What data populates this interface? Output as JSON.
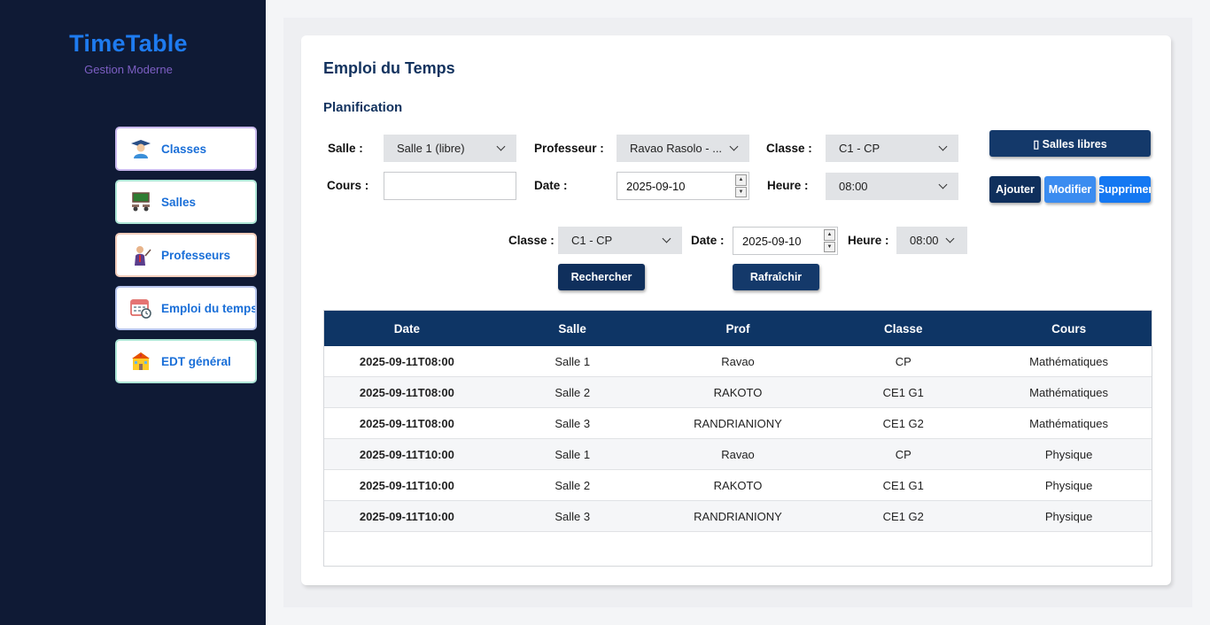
{
  "brand": {
    "title": "TimeTable",
    "subtitle": "Gestion Moderne"
  },
  "sidebar": {
    "items": [
      {
        "label": "Classes",
        "icon": "student-icon"
      },
      {
        "label": "Salles",
        "icon": "classroom-icon"
      },
      {
        "label": "Professeurs",
        "icon": "teacher-icon"
      },
      {
        "label": "Emploi du temps",
        "icon": "calendar-clock-icon"
      },
      {
        "label": "EDT général",
        "icon": "school-building-icon"
      }
    ]
  },
  "main": {
    "title": "Emploi du Temps",
    "section": "Planification",
    "form": {
      "salle_label": "Salle :",
      "salle_value": "Salle 1 (libre)",
      "professeur_label": "Professeur :",
      "professeur_value": "Ravao Rasolo - ...",
      "classe_label": "Classe :",
      "classe_value": "C1 - CP",
      "cours_label": "Cours :",
      "cours_value": "",
      "date_label": "Date :",
      "date_value": "2025-09-10",
      "heure_label": "Heure :",
      "heure_value": "08:00"
    },
    "buttons": {
      "salles_libres": "▯ Salles libres",
      "ajouter": "Ajouter",
      "modifier": "Modifier",
      "supprimer": "Supprimer"
    },
    "search": {
      "classe_label": "Classe :",
      "classe_value": "C1 - CP",
      "date_label": "Date :",
      "date_value": "2025-09-10",
      "heure_label": "Heure :",
      "heure_value": "08:00",
      "rechercher": "Rechercher",
      "rafraichir": "Rafraîchir"
    },
    "table": {
      "columns": [
        "Date",
        "Salle",
        "Prof",
        "Classe",
        "Cours"
      ],
      "rows": [
        [
          "2025-09-11T08:00",
          "Salle 1",
          "Ravao",
          "CP",
          "Mathématiques"
        ],
        [
          "2025-09-11T08:00",
          "Salle 2",
          "RAKOTO",
          "CE1 G1",
          "Mathématiques"
        ],
        [
          "2025-09-11T08:00",
          "Salle 3",
          "RANDRIANIONY",
          "CE1 G2",
          "Mathématiques"
        ],
        [
          "2025-09-11T10:00",
          "Salle 1",
          "Ravao",
          "CP",
          "Physique"
        ],
        [
          "2025-09-11T10:00",
          "Salle 2",
          "RAKOTO",
          "CE1 G1",
          "Physique"
        ],
        [
          "2025-09-11T10:00",
          "Salle 3",
          "RANDRIANIONY",
          "CE1 G2",
          "Physique"
        ]
      ]
    }
  },
  "colors": {
    "sidebar_bg": "#0f1a35",
    "brand": "#1e7bf0",
    "brand_sub": "#7d5fc4",
    "header_bg": "#0e3565",
    "accent_blue": "#1478f2"
  }
}
